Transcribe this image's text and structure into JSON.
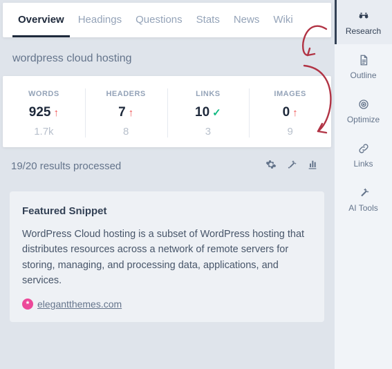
{
  "tabs": {
    "items": [
      "Overview",
      "Headings",
      "Questions",
      "Stats",
      "News",
      "Wiki"
    ],
    "activeIndex": 0
  },
  "query": "wordpress cloud hosting",
  "stats": [
    {
      "label": "WORDS",
      "value": "925",
      "indicator": "up",
      "target": "1.7k"
    },
    {
      "label": "HEADERS",
      "value": "7",
      "indicator": "up",
      "target": "8"
    },
    {
      "label": "LINKS",
      "value": "10",
      "indicator": "ok",
      "target": "3"
    },
    {
      "label": "IMAGES",
      "value": "0",
      "indicator": "up",
      "target": "9"
    }
  ],
  "progress": "19/20 results processed",
  "snippet": {
    "title": "Featured Snippet",
    "body": "WordPress Cloud hosting is a subset of WordPress hosting that distributes resources across a network of remote servers for storing, managing, and processing data, applications, and services.",
    "source": "elegantthemes.com",
    "source_badge": "*"
  },
  "sidebar": {
    "items": [
      {
        "label": "Research",
        "icon": "binoculars",
        "active": true
      },
      {
        "label": "Outline",
        "icon": "file",
        "active": false
      },
      {
        "label": "Optimize",
        "icon": "target",
        "active": false
      },
      {
        "label": "Links",
        "icon": "link",
        "active": false
      },
      {
        "label": "AI Tools",
        "icon": "wand",
        "active": false
      }
    ]
  },
  "icons": {
    "up": "↑",
    "check": "✓"
  },
  "colors": {
    "bgPanel": "#dfe4eb",
    "textMuted": "#94a3b8",
    "danger": "#f05252",
    "success": "#10b981"
  }
}
